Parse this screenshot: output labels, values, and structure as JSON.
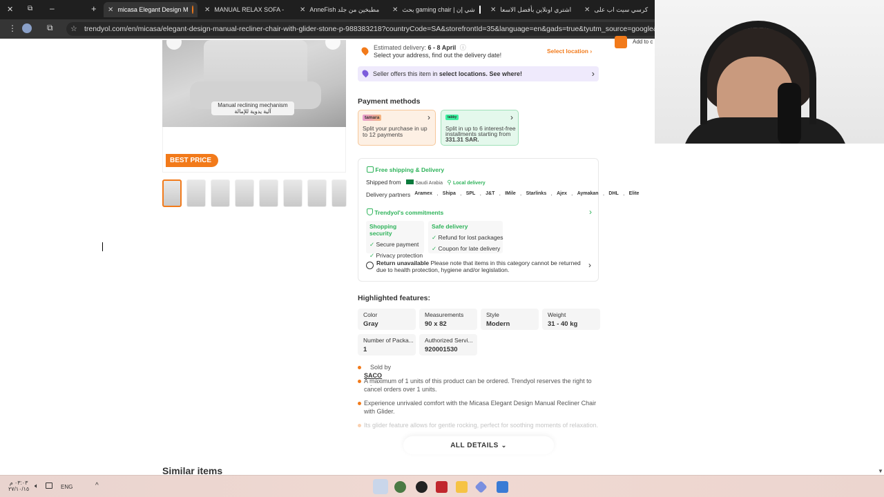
{
  "browser": {
    "tabs": [
      {
        "title": "micasa Elegant Design M",
        "active": true
      },
      {
        "title": "MANUAL RELAX SOFA - ",
        "active": false
      },
      {
        "title": "AnneFish مطبخين من جلد",
        "active": false
      },
      {
        "title": "بحث gaming chair | شي إن",
        "active": false
      },
      {
        "title": "اشتري اونلاين بأفضل الاسعا",
        "active": false
      },
      {
        "title": "كرسي سيت اب على",
        "active": false
      }
    ],
    "url": "trendyol.com/en/micasa/elegant-design-manual-recliner-chair-with-glider-stone-p-988383218?countryCode=SA&storefrontId=35&language=en&gads=true&tyutm_source=google&tyutm_medium=c"
  },
  "gallery": {
    "caption_en": "Manual reclining mechanism",
    "caption_ar": "آلية يدوية للإمالة",
    "badge": "BEST PRICE",
    "thumbnail_count": 8
  },
  "cart": {
    "add_label": "Add to c"
  },
  "delivery": {
    "estimated_label": "Estimated delivery:",
    "estimated_dates": "6 - 8 April",
    "hint": "Select your address, find out the delivery date!",
    "select_location": "Select location",
    "seller_prefix": "Seller offers this item in",
    "seller_bold": "select locations.",
    "seller_link": "See where!"
  },
  "payment": {
    "title": "Payment methods",
    "cards": [
      {
        "brand": "tamara",
        "text": "Split your purchase in up to 12 payments",
        "color": "#fbe9d9"
      },
      {
        "brand": "tabby",
        "text": "Split in up to 6 interest-free installments starting from",
        "amount": "331.31 SAR.",
        "color": "#dff7e9"
      }
    ]
  },
  "shipping": {
    "free_label": "Free shipping & Delivery",
    "shipped_from_label": "Shipped from",
    "origin": "Saudi Arabia",
    "local": "Local delivery",
    "partners_label": "Delivery partners",
    "partners": [
      "Aramex",
      "Shipa",
      "SPL",
      "J&T",
      "IMile",
      "Starlinks",
      "Ajex",
      "Aymakan",
      "DHL",
      "Elite"
    ],
    "commitments_title": "Trendyol's commitments",
    "security_title": "Shopping security",
    "security_items": [
      "Secure payment",
      "Privacy protection"
    ],
    "safe_title": "Safe delivery",
    "safe_items": [
      "Refund for lost packages",
      "Coupon for late delivery"
    ],
    "return_title": "Return unavailable",
    "return_text": "Please note that items in this category cannot be returned due to health protection, hygiene and/or legislation."
  },
  "features": {
    "title": "Highlighted features:",
    "items": [
      {
        "label": "Color",
        "value": "Gray"
      },
      {
        "label": "Measurements",
        "value": "90 x 82"
      },
      {
        "label": "Style",
        "value": "Modern"
      },
      {
        "label": "Weight",
        "value": "31 - 40 kg"
      },
      {
        "label": "Number of Packa...",
        "value": "1"
      },
      {
        "label": "Authorized Servi...",
        "value": "920001530"
      }
    ]
  },
  "details": {
    "sold_by_label": "Sold by",
    "seller": "SACO",
    "bullets": [
      "A maximum of 1 units of this product can be ordered. Trendyol reserves the right to cancel orders over 1 units.",
      "Experience unrivaled comfort with the Micasa Elegant Design Manual Recliner Chair with Glider.",
      "Its glider feature allows for gentle rocking, perfect for soothing moments of relaxation."
    ],
    "all_details": "ALL DETAILS"
  },
  "similar": {
    "title": "Similar items"
  },
  "taskbar": {
    "time": "٠٣:٠٣ م",
    "date": "٢٧/١٠/١٥",
    "lang": "ENG"
  },
  "colors": {
    "accent": "#f27a1a",
    "green": "#2eb35a",
    "seller_bg": "#efeafc"
  }
}
